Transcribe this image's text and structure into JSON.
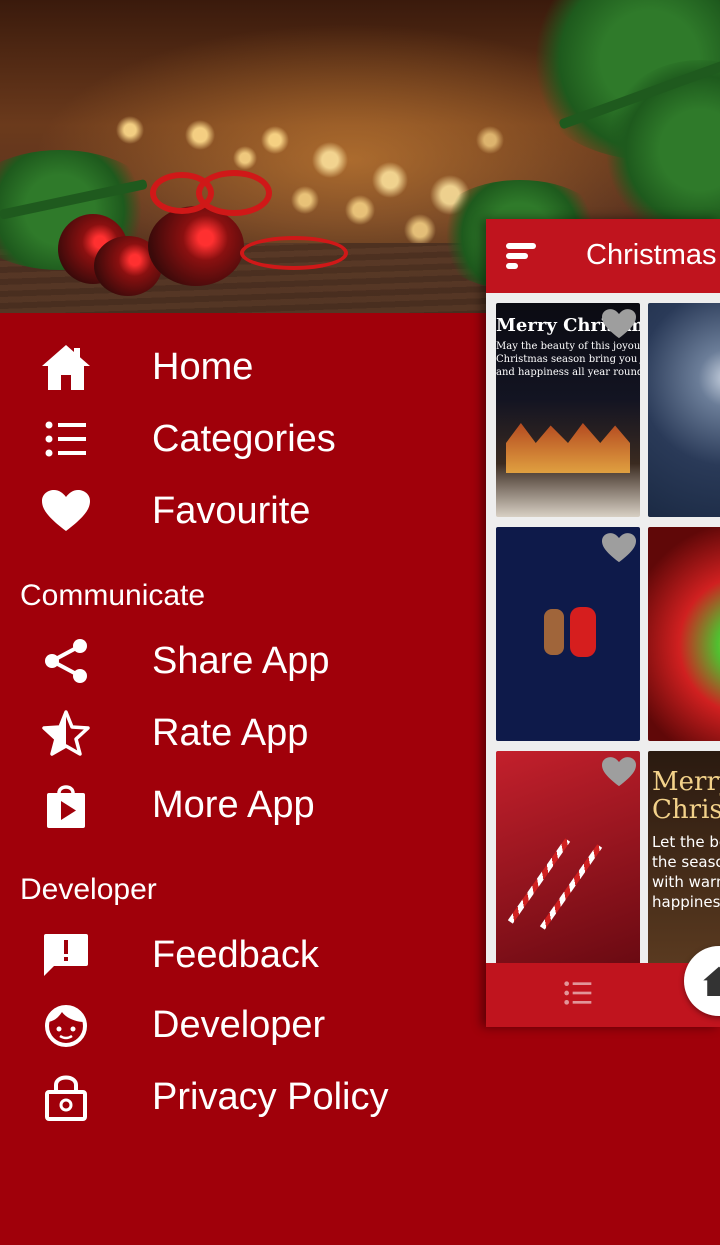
{
  "drawer": {
    "header_image": "christmas-ornaments-banner",
    "items": [
      {
        "label": "Home",
        "icon": "home-icon"
      },
      {
        "label": "Categories",
        "icon": "list-icon"
      },
      {
        "label": "Favourite",
        "icon": "heart-icon"
      }
    ],
    "sections": [
      {
        "title": "Communicate",
        "items": [
          {
            "label": "Share App",
            "icon": "share-icon"
          },
          {
            "label": "Rate App",
            "icon": "star-icon"
          },
          {
            "label": "More App",
            "icon": "play-store-icon"
          }
        ]
      },
      {
        "title": "Developer",
        "items": [
          {
            "label": "Feedback",
            "icon": "feedback-icon"
          },
          {
            "label": "Developer",
            "icon": "developer-face-icon"
          },
          {
            "label": "Privacy Policy",
            "icon": "lock-icon"
          }
        ]
      }
    ]
  },
  "main": {
    "toolbar_title": "Christmas",
    "tiles": [
      {
        "heading": "Merry Christmas",
        "lines": [
          "May the beauty of this joyous",
          "Christmas season bring you joy",
          "and happiness all year round."
        ]
      },
      {
        "heading": "",
        "lines": []
      },
      {
        "heading": "",
        "lines": []
      },
      {
        "heading": "",
        "lines": []
      },
      {
        "heading": "",
        "lines": []
      },
      {
        "heading": "Merry Christmas",
        "heading_lines": [
          "Merry",
          "Christm"
        ],
        "lines": [
          "Let the be",
          "the seaso",
          "with warm",
          "happiness"
        ]
      }
    ]
  },
  "colors": {
    "drawer_bg": "#a0000a",
    "toolbar_bg": "#c0141e",
    "text": "#ffffff"
  }
}
